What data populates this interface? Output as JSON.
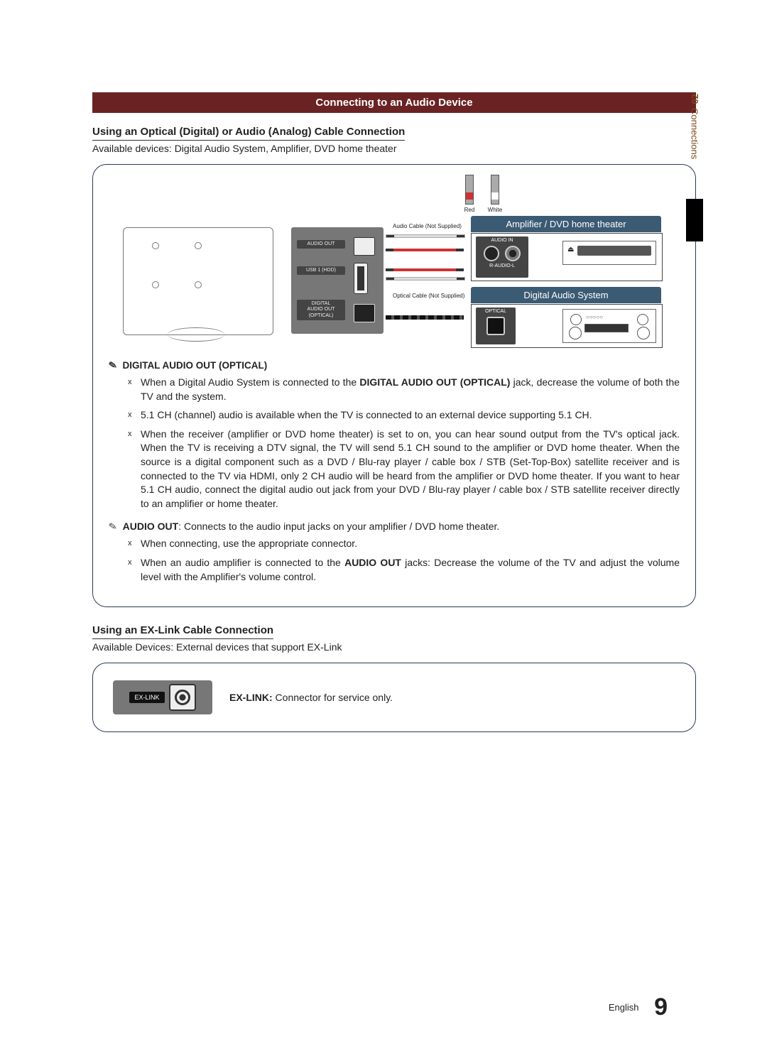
{
  "sidebar": {
    "number": "02",
    "label": "Connections"
  },
  "header": {
    "title": "Connecting to an Audio Device"
  },
  "section1": {
    "heading": "Using an Optical (Digital) or Audio (Analog) Cable Connection",
    "subtext": "Available devices: Digital Audio System, Amplifier, DVD home theater"
  },
  "diagram": {
    "rca_red": "Red",
    "rca_white": "White",
    "audio_cable": "Audio Cable (Not Supplied)",
    "optical_cable": "Optical Cable (Not Supplied)",
    "amp_header": "Amplifier / DVD home theater",
    "das_header": "Digital Audio System",
    "port_audio_out": "AUDIO OUT",
    "port_usb": "USB 1 (HDD)",
    "port_digital": "DIGITAL\nAUDIO OUT\n(OPTICAL)",
    "audio_in": "AUDIO IN",
    "r_audio_l": "R-AUDIO-L",
    "optical": "OPTICAL"
  },
  "notes": {
    "dao_heading": "DIGITAL AUDIO OUT (OPTICAL)",
    "dao_bullets": [
      "When a Digital Audio System is connected to the DIGITAL AUDIO OUT (OPTICAL) jack, decrease the volume of both the TV and the system.",
      "5.1 CH (channel) audio is available when the TV is connected to an external device supporting 5.1 CH.",
      "When the receiver (amplifier or DVD home theater) is set to on, you can hear sound output from the TV's optical jack. When the TV is receiving a DTV signal, the TV will send 5.1 CH sound to the amplifier or DVD home theater. When the source is a digital component such as a DVD / Blu-ray player / cable box / STB (Set-Top-Box) satellite receiver and is connected to the TV via HDMI, only 2 CH audio will be heard from the amplifier or DVD home theater. If you want to hear 5.1 CH audio, connect the digital audio out jack from your DVD / Blu-ray player / cable box / STB satellite receiver directly to an amplifier or home theater."
    ],
    "audio_out_label": "AUDIO OUT",
    "audio_out_text": ": Connects to the audio input jacks on your amplifier / DVD home theater.",
    "audio_out_bullets": [
      "When connecting, use the appropriate connector.",
      "When an audio amplifier is connected to the AUDIO OUT jacks: Decrease the volume of the TV and adjust the volume level with the Amplifier's volume control."
    ]
  },
  "exlink": {
    "heading": "Using an EX-Link Cable Connection",
    "subtext": "Available Devices: External devices that support EX-Link",
    "port_label": "EX-LINK",
    "desc_label": "EX-LINK:",
    "desc_text": " Connector for service only."
  },
  "footer": {
    "lang": "English",
    "page": "9"
  }
}
